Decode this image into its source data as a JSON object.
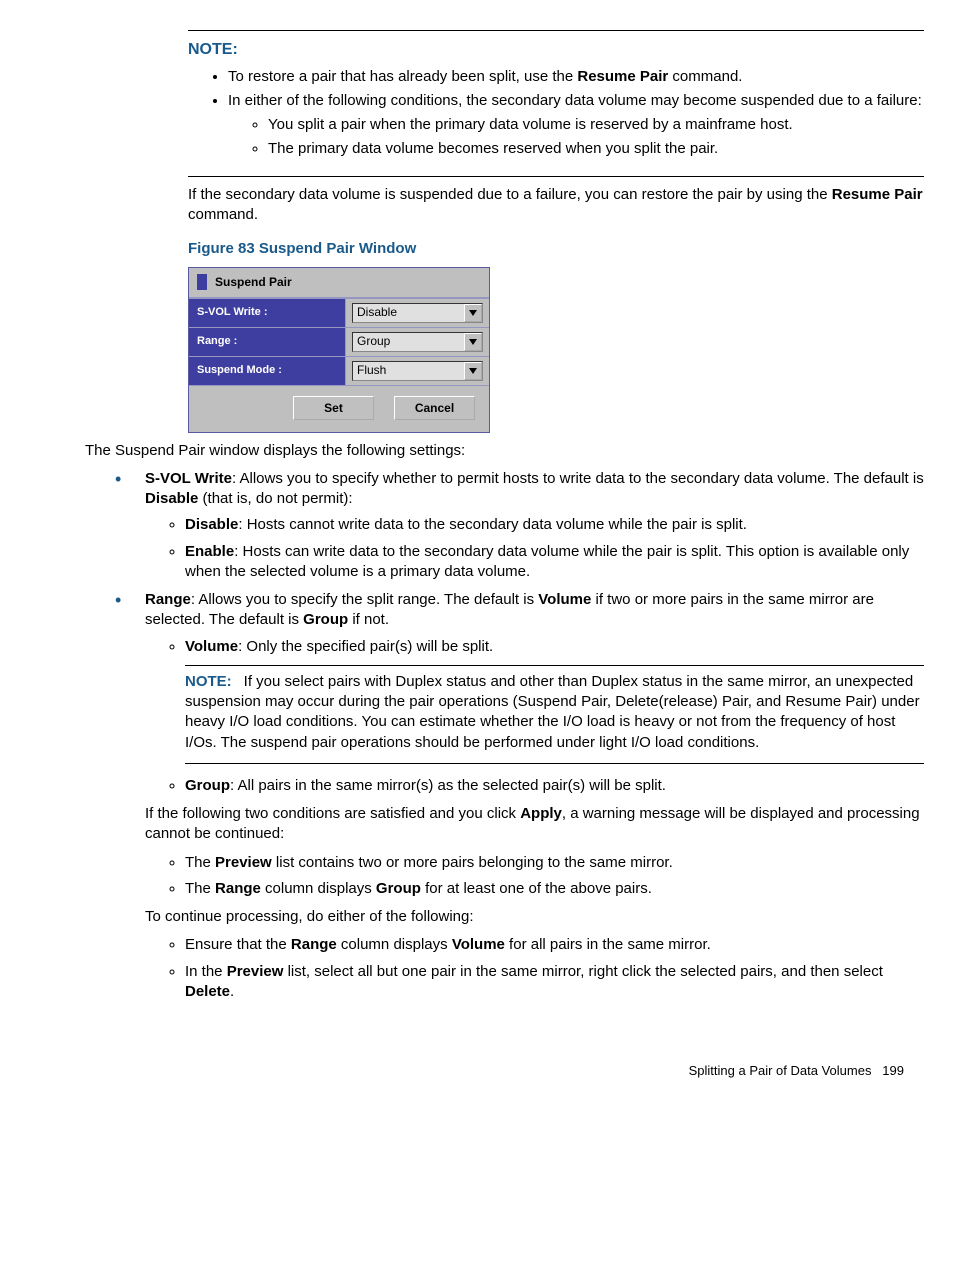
{
  "note1": {
    "heading": "NOTE:",
    "b1_pre": "To restore a pair that has already been split, use the ",
    "b1_bold": "Resume Pair",
    "b1_post": " command.",
    "b2": "In either of the following conditions, the secondary data volume may become suspended due to a failure:",
    "b2_s1": "You split a pair when the primary data volume is reserved by a mainframe host.",
    "b2_s2": "The primary data volume becomes reserved when you split the pair."
  },
  "after_note_pre": "If the secondary data volume is suspended due to a failure, you can restore the pair by using the ",
  "after_note_bold": "Resume Pair",
  "after_note_post": " command.",
  "fig_caption": "Figure 83 Suspend Pair Window",
  "figure": {
    "title": "Suspend Pair",
    "row1_label": "S-VOL Write :",
    "row1_value": "Disable",
    "row2_label": "Range :",
    "row2_value": "Group",
    "row3_label": "Suspend Mode :",
    "row3_value": "Flush",
    "btn_set": "Set",
    "btn_cancel": "Cancel"
  },
  "intro": "The Suspend Pair window displays the following settings:",
  "svol": {
    "bold": "S-VOL Write",
    "text1": ": Allows you to specify whether to permit hosts to write data to the secondary data volume. The default is ",
    "bold2": "Disable",
    "text2": " (that is, do not permit):",
    "disable_b": "Disable",
    "disable_t": ": Hosts cannot write data to the secondary data volume while the pair is split.",
    "enable_b": "Enable",
    "enable_t": ": Hosts can write data to the secondary data volume while the pair is split. This option is available only when the selected volume is a primary data volume."
  },
  "range": {
    "bold": "Range",
    "t1": ": Allows you to specify the split range. The default is ",
    "b2": "Volume",
    "t2": " if two or more pairs in the same mirror are selected. The default is ",
    "b3": "Group",
    "t3": " if not.",
    "vol_b": "Volume",
    "vol_t": ": Only the specified pair(s) will be split.",
    "note_label": "NOTE:",
    "note_text": "If you select pairs with Duplex status and other than Duplex status in the same mirror, an unexpected suspension may occur during the pair operations (Suspend Pair, Delete(release) Pair, and Resume Pair) under heavy I/O load conditions. You can estimate whether the I/O load is heavy or not from the frequency of host I/Os. The suspend pair operations should be performed under light I/O load conditions.",
    "grp_b": "Group",
    "grp_t": ": All pairs in the same mirror(s) as the selected pair(s) will be split.",
    "cond_pre": "If the following two conditions are satisfied and you click ",
    "cond_b": "Apply",
    "cond_post": ", a warning message will be displayed and processing cannot be continued:",
    "c1_pre": "The ",
    "c1_b": "Preview",
    "c1_post": " list contains two or more pairs belonging to the same mirror.",
    "c2_pre": "The ",
    "c2_b1": "Range",
    "c2_mid": " column displays ",
    "c2_b2": "Group",
    "c2_post": " for at least one of the above pairs.",
    "cont": "To continue processing, do either of the following:",
    "e1_pre": "Ensure that the ",
    "e1_b1": "Range",
    "e1_mid": " column displays ",
    "e1_b2": "Volume",
    "e1_post": " for all pairs in the same mirror.",
    "e2_pre": "In the ",
    "e2_b1": "Preview",
    "e2_mid": " list, select all but one pair in the same mirror, right click the selected pairs, and then select ",
    "e2_b2": "Delete",
    "e2_post": "."
  },
  "footer_text": "Splitting a Pair of Data Volumes",
  "footer_page": "199"
}
